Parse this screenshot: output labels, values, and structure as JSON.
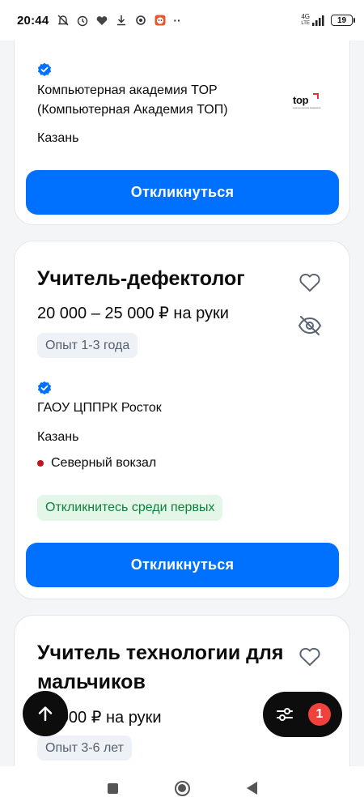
{
  "status_bar": {
    "time": "20:44",
    "network_label": "4G",
    "network_sub": "LTE",
    "battery": "19"
  },
  "vacancies": [
    {
      "company": "Компьютерная академия TOP (Компьютерная Академия ТОП)",
      "logo_text": "top",
      "logo_subtext": "компьютерная академия",
      "city": "Казань",
      "apply_label": "Откликнуться"
    },
    {
      "title": "Учитель-дефектолог",
      "salary": "20 000 – 25 000 ₽ на руки",
      "experience": "Опыт 1-3 года",
      "company": "ГАОУ ЦППРК Росток",
      "city": "Казань",
      "metro": "Северный вокзал",
      "metro_color": "#c2141f",
      "badge": "Откликнитесь среди первых",
      "apply_label": "Откликнуться"
    },
    {
      "title": "Учитель технологии для мальчиков",
      "salary": "45 000 ₽ на руки",
      "experience": "Опыт 3-6 лет"
    }
  ],
  "filter": {
    "count": "1"
  },
  "icons": {
    "verified": "verified-badge-icon",
    "favorite": "heart-icon",
    "hide": "eye-off-icon",
    "scroll_top": "arrow-up-icon",
    "filter": "filter-sliders-icon"
  },
  "colors": {
    "accent": "#0070ff",
    "green_badge_text": "#11803c",
    "filter_count_bg": "#f0413a"
  }
}
